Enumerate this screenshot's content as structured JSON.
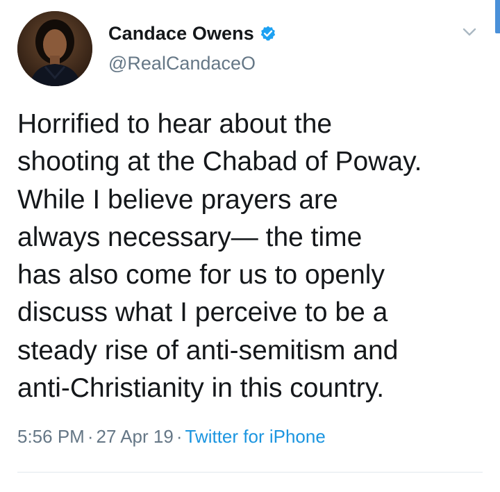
{
  "author": {
    "display_name": "Candace Owens",
    "handle": "@RealCandaceO",
    "verified": true,
    "verified_icon": "verified-badge-icon",
    "avatar_icon": "profile-photo"
  },
  "tweet": {
    "text": "Horrified to hear about the\nshooting at the Chabad of Poway.\nWhile I believe prayers are\nalways necessary— the time\nhas also come for us to openly\ndiscuss what I perceive to be a\nsteady rise of anti-semitism and\nanti-Christianity in this country.",
    "time": "5:56 PM",
    "date": "27 Apr 19",
    "source": "Twitter for iPhone",
    "separator": "·"
  },
  "colors": {
    "text": "#14171a",
    "secondary_text": "#657786",
    "link": "#1b95e0",
    "verified": "#1da1f2",
    "scrollbar": "#4a90d9"
  }
}
